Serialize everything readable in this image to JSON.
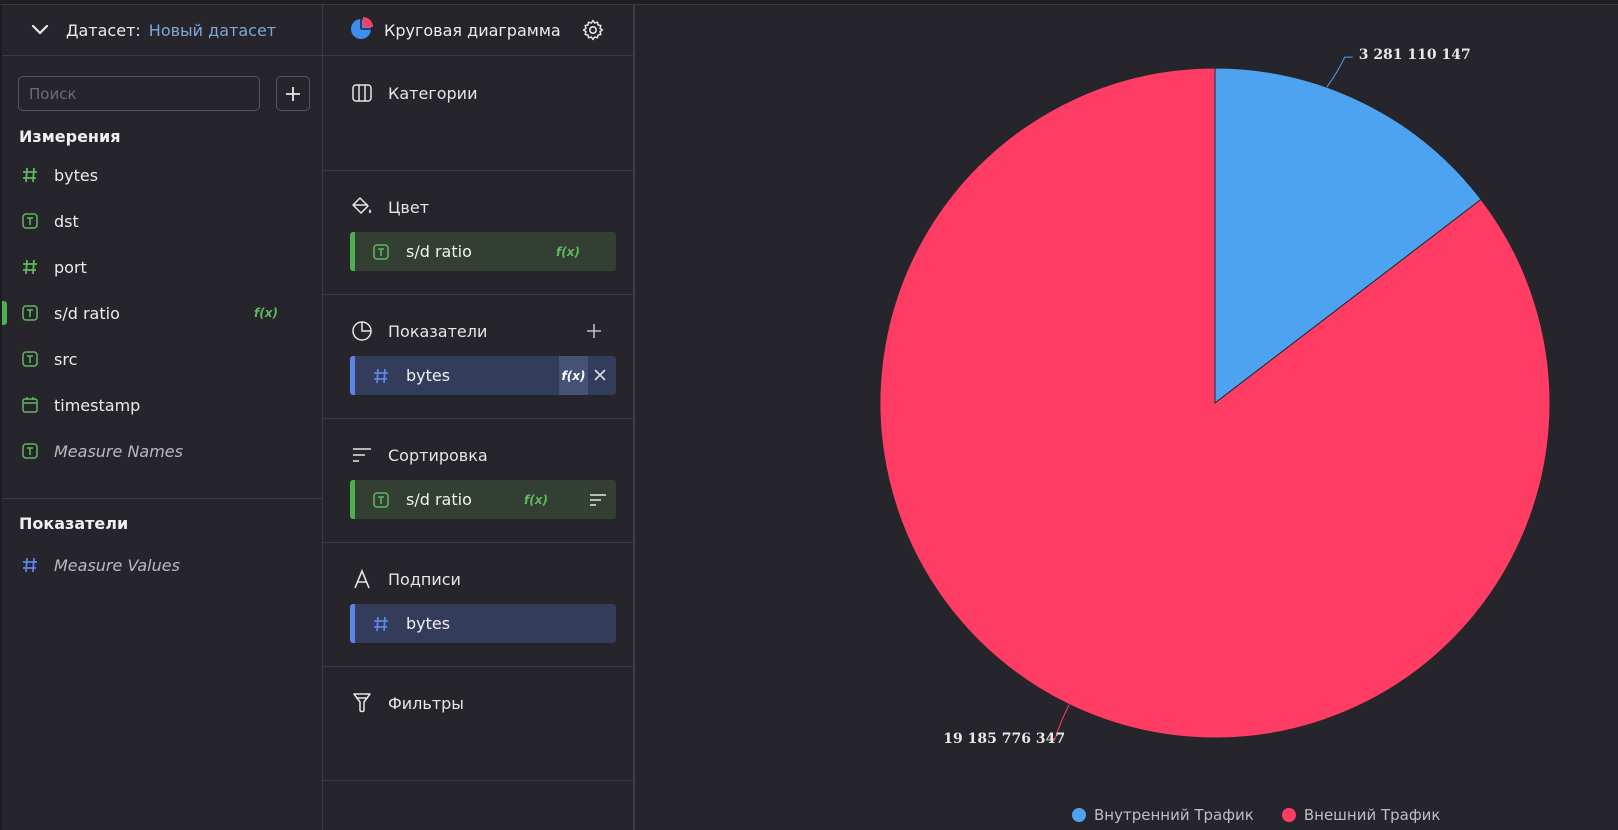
{
  "dataset": {
    "label": "Датасет:",
    "name": "Новый датасет",
    "search_placeholder": "Поиск",
    "dimensions_title": "Измерения",
    "dimensions": [
      {
        "label": "bytes",
        "type": "number"
      },
      {
        "label": "dst",
        "type": "text"
      },
      {
        "label": "port",
        "type": "number"
      },
      {
        "label": "s/d ratio",
        "type": "text",
        "formula": "f(x)"
      },
      {
        "label": "src",
        "type": "text"
      },
      {
        "label": "timestamp",
        "type": "date"
      },
      {
        "label": "Measure Names",
        "type": "text"
      }
    ],
    "measures_title": "Показатели",
    "measures": [
      {
        "label": "Measure Values",
        "type": "number"
      }
    ]
  },
  "visualization": {
    "type_label": "Круговая диаграмма",
    "sections": {
      "categories": {
        "title": "Категории"
      },
      "color": {
        "title": "Цвет",
        "field": "s/d ratio",
        "formula": "f(x)"
      },
      "measures": {
        "title": "Показатели",
        "field": "bytes",
        "formula": "f(x)"
      },
      "sort": {
        "title": "Сортировка",
        "field": "s/d ratio",
        "formula": "f(x)"
      },
      "labels": {
        "title": "Подписи",
        "field": "bytes"
      },
      "filters": {
        "title": "Фильтры"
      }
    }
  },
  "colors": {
    "inner": "#4da3f0",
    "outer": "#ff3d64",
    "green_accent": "#4caf50",
    "blue_accent": "#5b85e8"
  },
  "chart_data": {
    "type": "pie",
    "categories": [
      "Внутренний Трафик",
      "Внешний Трафик"
    ],
    "values": [
      3281110147,
      19185776347
    ],
    "value_labels": [
      "3 281 110 147",
      "19 185 776 347"
    ],
    "legend_position": "bottom"
  }
}
